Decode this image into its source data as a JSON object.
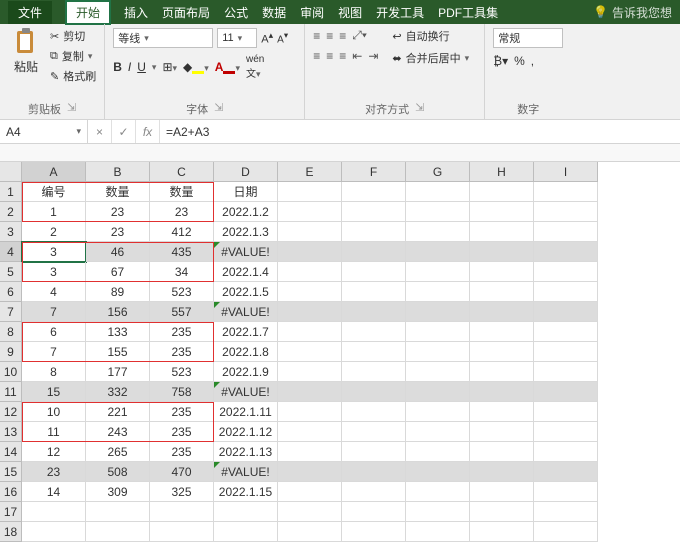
{
  "titlebar": {
    "tabs": [
      "文件",
      "开始",
      "插入",
      "页面布局",
      "公式",
      "数据",
      "审阅",
      "视图",
      "开发工具",
      "PDF工具集"
    ],
    "active": 1,
    "tell": "告诉我您想"
  },
  "ribbon": {
    "clipboard": {
      "paste": "粘贴",
      "cut": "剪切",
      "copy": "复制",
      "painter": "格式刷",
      "label": "剪贴板"
    },
    "font": {
      "name": "等线",
      "size": "11",
      "label": "字体",
      "bold": "B",
      "italic": "I",
      "underline": "U"
    },
    "align": {
      "label": "对齐方式",
      "wrap": "自动换行",
      "merge": "合并后居中"
    },
    "number": {
      "format": "常规",
      "label": "数字"
    }
  },
  "formula_bar": {
    "ref": "A4",
    "fx": "fx",
    "value": "=A2+A3"
  },
  "columns": [
    "A",
    "B",
    "C",
    "D",
    "E",
    "F",
    "G",
    "H",
    "I"
  ],
  "row_headers": [
    1,
    2,
    3,
    4,
    5,
    6,
    7,
    8,
    9,
    10,
    11,
    12,
    13,
    14,
    15,
    16,
    17,
    18
  ],
  "active_cell": "A4",
  "shaded_rows": [
    4,
    7,
    11,
    15
  ],
  "data": {
    "r1": {
      "A": "编号",
      "B": "数量",
      "C": "数量",
      "D": "日期"
    },
    "r2": {
      "A": "1",
      "B": "23",
      "C": "23",
      "D": "2022.1.2"
    },
    "r3": {
      "A": "2",
      "B": "23",
      "C": "412",
      "D": "2022.1.3"
    },
    "r4": {
      "A": "3",
      "B": "46",
      "C": "435",
      "D": "#VALUE!"
    },
    "r5": {
      "A": "3",
      "B": "67",
      "C": "34",
      "D": "2022.1.4"
    },
    "r6": {
      "A": "4",
      "B": "89",
      "C": "523",
      "D": "2022.1.5"
    },
    "r7": {
      "A": "7",
      "B": "156",
      "C": "557",
      "D": "#VALUE!"
    },
    "r8": {
      "A": "6",
      "B": "133",
      "C": "235",
      "D": "2022.1.7"
    },
    "r9": {
      "A": "7",
      "B": "155",
      "C": "235",
      "D": "2022.1.8"
    },
    "r10": {
      "A": "8",
      "B": "177",
      "C": "523",
      "D": "2022.1.9"
    },
    "r11": {
      "A": "15",
      "B": "332",
      "C": "758",
      "D": "#VALUE!"
    },
    "r12": {
      "A": "10",
      "B": "221",
      "C": "235",
      "D": "2022.1.11"
    },
    "r13": {
      "A": "11",
      "B": "243",
      "C": "235",
      "D": "2022.1.12"
    },
    "r14": {
      "A": "12",
      "B": "265",
      "C": "235",
      "D": "2022.1.13"
    },
    "r15": {
      "A": "23",
      "B": "508",
      "C": "470",
      "D": "#VALUE!"
    },
    "r16": {
      "A": "14",
      "B": "309",
      "C": "325",
      "D": "2022.1.15"
    }
  },
  "icons": {
    "bulb": "💡",
    "scissors": "✂",
    "copy": "⧉",
    "brush": "✎"
  },
  "colors": {
    "accent": "#217346",
    "fill": "#ffff00",
    "font": "#c00000"
  }
}
